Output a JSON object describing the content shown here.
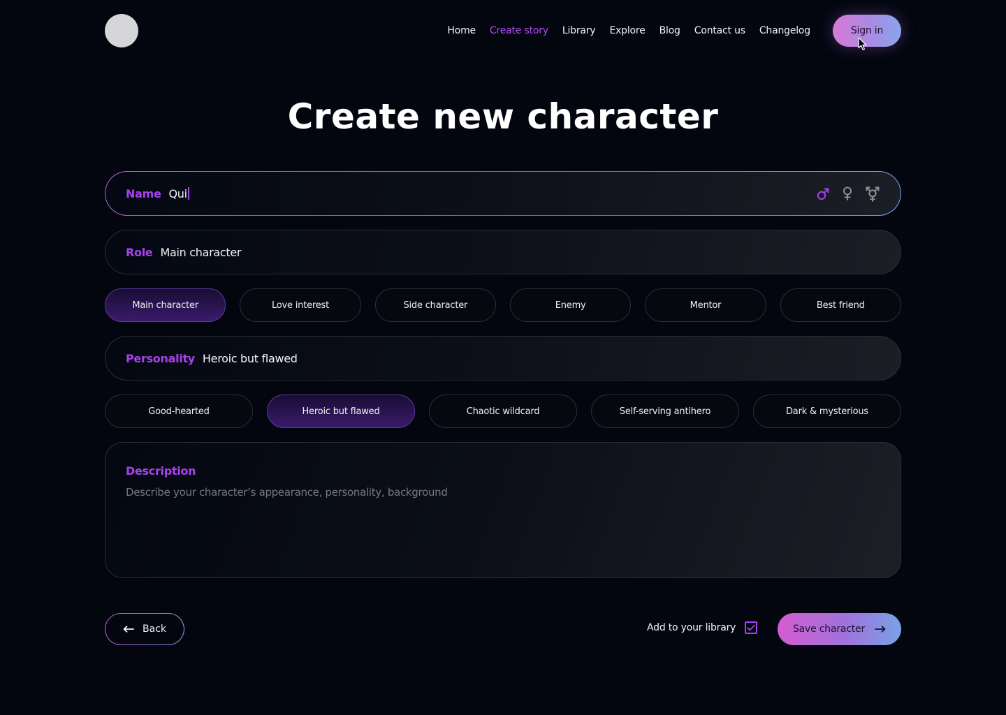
{
  "nav": {
    "items": [
      {
        "label": "Home",
        "active": false
      },
      {
        "label": "Create story",
        "active": true
      },
      {
        "label": "Library",
        "active": false
      },
      {
        "label": "Explore",
        "active": false
      },
      {
        "label": "Blog",
        "active": false
      },
      {
        "label": "Contact us",
        "active": false
      },
      {
        "label": "Changelog",
        "active": false
      }
    ],
    "sign_in_label": "Sign in"
  },
  "page_title": "Create new character",
  "name_field": {
    "label": "Name",
    "value": "Qui",
    "gender_options": [
      "male-icon",
      "female-icon",
      "transgender-icon"
    ],
    "selected_gender": "male-icon"
  },
  "role_field": {
    "label": "Role",
    "value": "Main character"
  },
  "role_options": [
    {
      "label": "Main character",
      "selected": true
    },
    {
      "label": "Love interest",
      "selected": false
    },
    {
      "label": "Side character",
      "selected": false
    },
    {
      "label": "Enemy",
      "selected": false
    },
    {
      "label": "Mentor",
      "selected": false
    },
    {
      "label": "Best friend",
      "selected": false
    }
  ],
  "personality_field": {
    "label": "Personality",
    "value": "Heroic but flawed"
  },
  "personality_options": [
    {
      "label": "Good-hearted",
      "selected": false
    },
    {
      "label": "Heroic but flawed",
      "selected": true
    },
    {
      "label": "Chaotic wildcard",
      "selected": false
    },
    {
      "label": "Self-serving antihero",
      "selected": false
    },
    {
      "label": "Dark & mysterious",
      "selected": false
    }
  ],
  "description": {
    "label": "Description",
    "placeholder": "Describe your character’s appearance, personality, background"
  },
  "footer": {
    "back_label": "Back",
    "library_label": "Add to your library",
    "library_checked": true,
    "save_label": "Save character"
  },
  "colors": {
    "background": "#03060f",
    "accent": "#a842ec",
    "gradient_start": "#d45ccf",
    "gradient_end": "#7aa1e6",
    "chip_selected": "#3a1a6b"
  }
}
